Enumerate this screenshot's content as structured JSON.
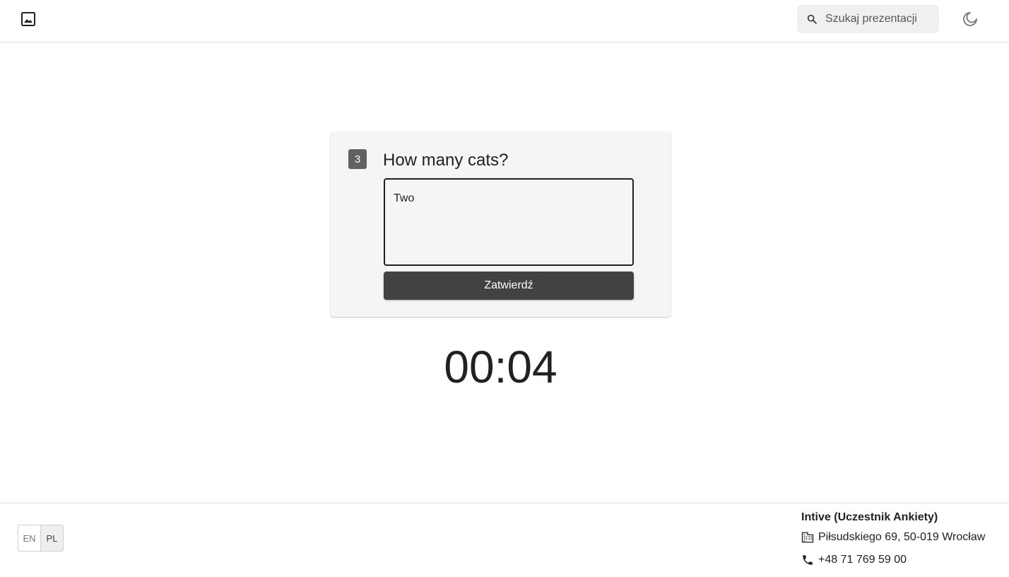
{
  "header": {
    "logo_icon": "image-icon",
    "search": {
      "placeholder": "Szukaj prezentacji",
      "icon": "search-icon"
    },
    "theme_toggle_icon": "moon-icon"
  },
  "question": {
    "number": "3",
    "title": "How many cats?",
    "answer_value": "Two",
    "submit_label": "Zatwierdź"
  },
  "timer": {
    "value": "00:04"
  },
  "footer": {
    "languages": [
      "EN",
      "PL"
    ],
    "active_language": "PL",
    "organization": "Intive (Uczestnik Ankiety)",
    "address": "Piłsudskiego 69, 50-019 Wrocław",
    "address_icon": "building-icon",
    "phone": "+48 71 769 59 00",
    "phone_icon": "phone-icon"
  },
  "colors": {
    "badge": "#616161",
    "button": "#424242",
    "card": "#f5f5f5",
    "search_bg": "#f0f0f0"
  }
}
